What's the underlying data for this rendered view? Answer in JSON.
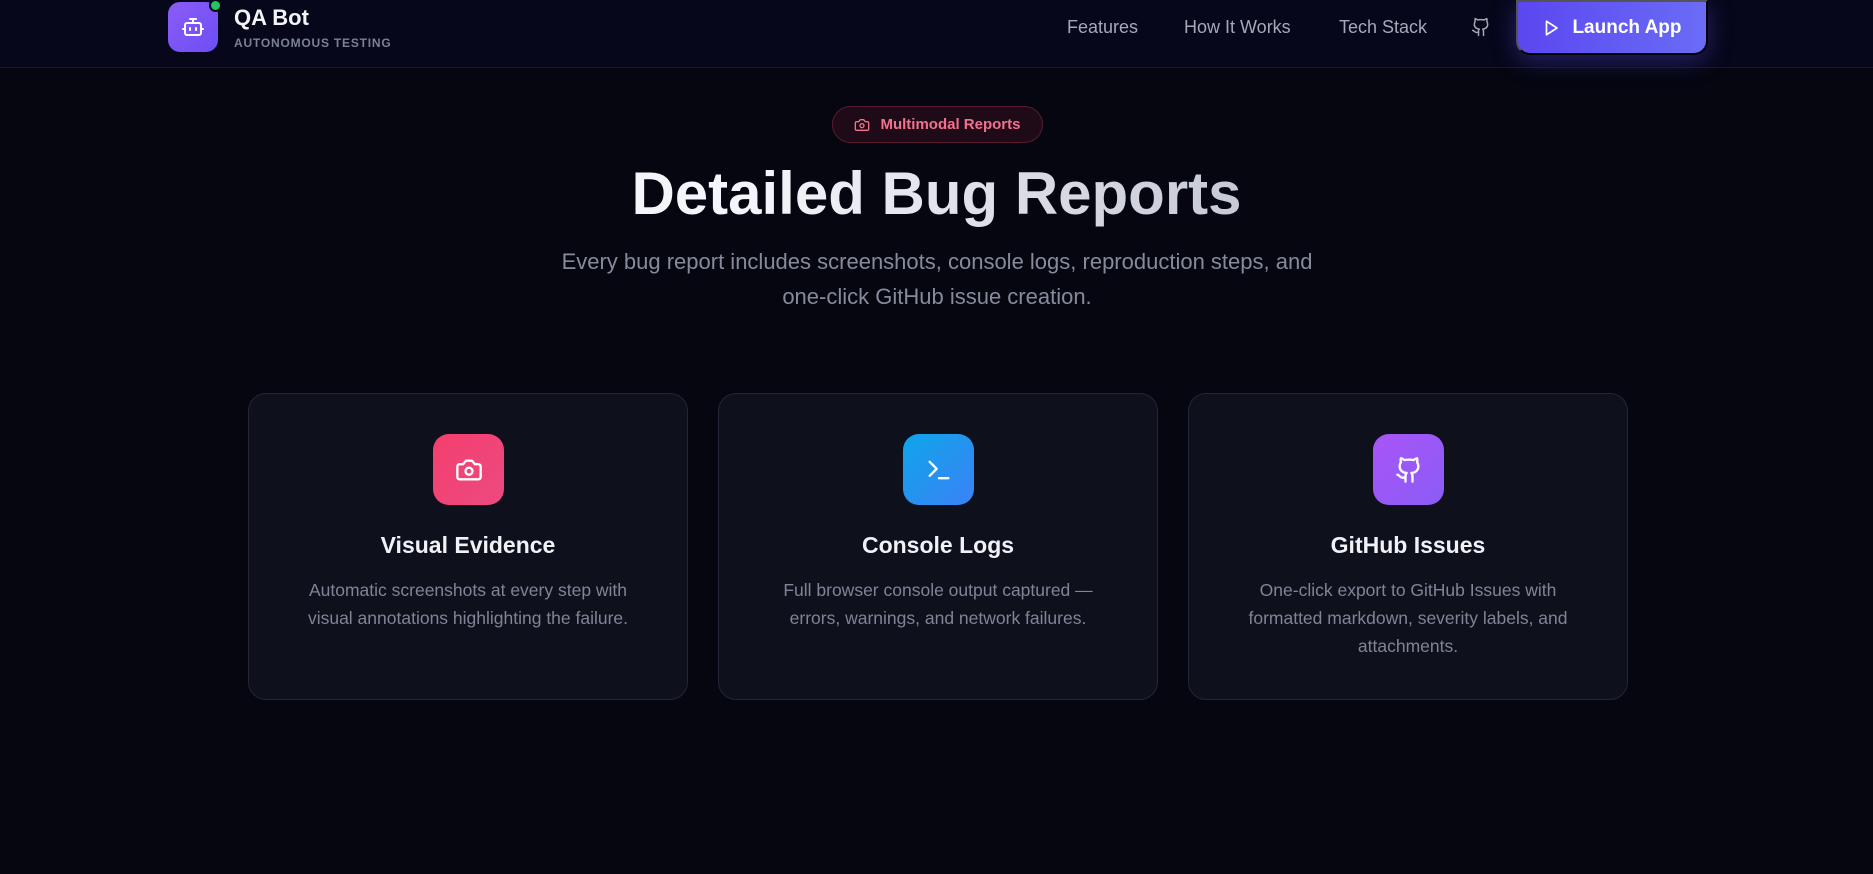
{
  "header": {
    "brand_name": "QA Bot",
    "brand_tagline": "AUTONOMOUS TESTING",
    "logo_icon": "robot-icon",
    "nav": [
      {
        "label": "Features"
      },
      {
        "label": "How It Works"
      },
      {
        "label": "Tech Stack"
      }
    ],
    "github_icon": "github-icon",
    "launch_label": "Launch App",
    "launch_icon": "play-icon"
  },
  "hero": {
    "badge_icon": "camera-icon",
    "badge_label": "Multimodal Reports",
    "title": "Detailed Bug Reports",
    "subtitle": "Every bug report includes screenshots, console logs, reproduction steps, and one-click GitHub issue creation."
  },
  "cards": [
    {
      "icon": "camera-icon",
      "title": "Visual Evidence",
      "description": "Automatic screenshots at every step with visual annotations highlighting the failure.",
      "accent_from": "#f43f6e",
      "accent_to": "#ec4a80"
    },
    {
      "icon": "terminal-icon",
      "title": "Console Logs",
      "description": "Full browser console output captured — errors, warnings, and network failures.",
      "accent_from": "#0ea5e9",
      "accent_to": "#3b82f6"
    },
    {
      "icon": "github-icon",
      "title": "GitHub Issues",
      "description": "One-click export to GitHub Issues with formatted markdown, severity labels, and attachments.",
      "accent_from": "#a855f7",
      "accent_to": "#8b5cf6"
    }
  ],
  "colors": {
    "background": "#05060f",
    "accent": "#5b47f0",
    "badge_text": "#f2718f",
    "status_dot": "#22c55e"
  }
}
